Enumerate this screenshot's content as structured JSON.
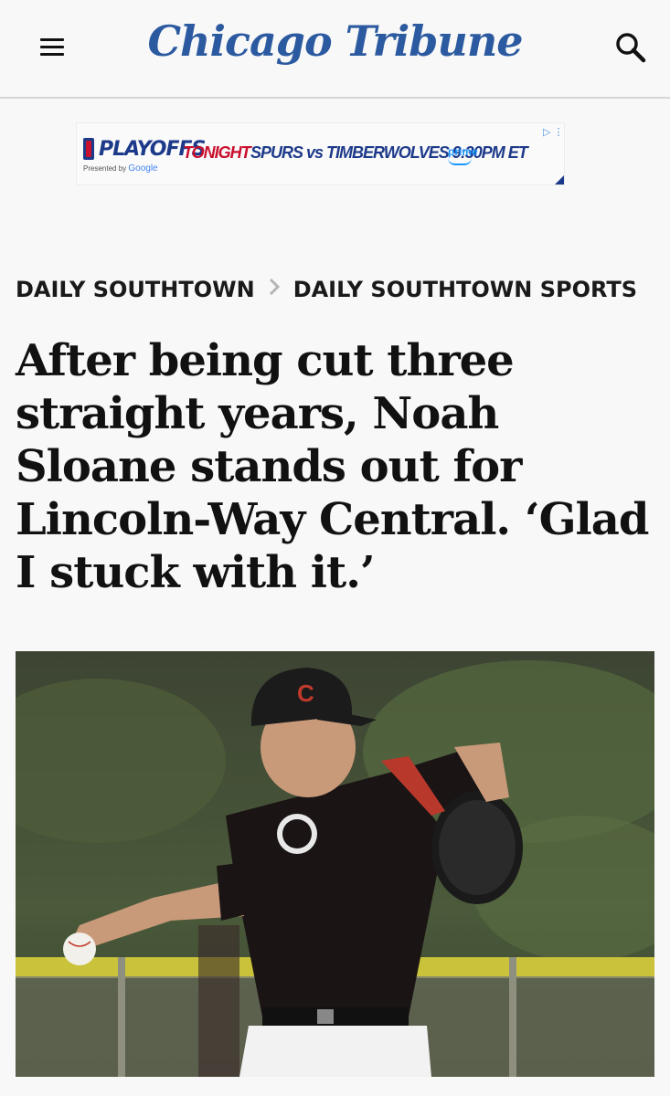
{
  "header": {
    "logo_text": "Chicago Tribune",
    "menu_icon": "hamburger-menu-icon",
    "search_icon": "search-icon",
    "brand_color": "#2c5aa0"
  },
  "ad": {
    "brand": "PLAYOFFS",
    "presented_prefix": "Presented by",
    "presented_brand": "Google",
    "tonight": "TONIGHT",
    "matchup": "SPURS vs TIMBERWOLVES 9:30PM ET",
    "partner": "prime",
    "adchoices_icon": "adchoices-icon"
  },
  "breadcrumb": {
    "items": [
      {
        "label": "DAILY SOUTHTOWN"
      },
      {
        "label": "DAILY SOUTHTOWN SPORTS"
      }
    ],
    "separator_icon": "chevron-right-icon"
  },
  "article": {
    "headline": "After being cut three straight years, Noah Sloane stands out for Lincoln-Way Central. ‘Glad I stuck with it.’"
  },
  "photo": {
    "cap_letter": "C"
  }
}
